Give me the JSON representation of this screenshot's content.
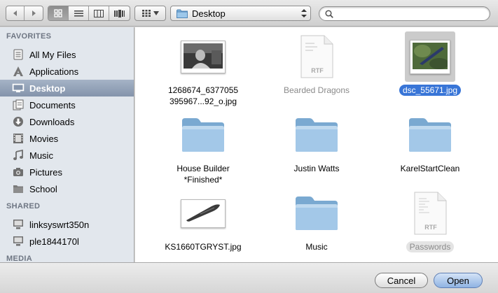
{
  "toolbar": {
    "nav": {
      "back_icon": "chevron-left-icon",
      "forward_icon": "chevron-right-icon"
    },
    "view_modes": [
      "icon-view-icon",
      "list-view-icon",
      "column-view-icon",
      "coverflow-view-icon"
    ],
    "active_view": "icon-view-icon",
    "arrange_icon": "grid-arrange-icon",
    "location": "Desktop",
    "search_value": ""
  },
  "sidebar": {
    "sections": [
      {
        "title": "FAVORITES",
        "items": [
          {
            "label": "All My Files",
            "icon": "all-files-icon"
          },
          {
            "label": "Applications",
            "icon": "applications-icon"
          },
          {
            "label": "Desktop",
            "icon": "desktop-icon",
            "selected": true
          },
          {
            "label": "Documents",
            "icon": "documents-icon"
          },
          {
            "label": "Downloads",
            "icon": "downloads-icon"
          },
          {
            "label": "Movies",
            "icon": "movies-icon"
          },
          {
            "label": "Music",
            "icon": "music-icon"
          },
          {
            "label": "Pictures",
            "icon": "pictures-icon"
          },
          {
            "label": "School",
            "icon": "folder-icon"
          }
        ]
      },
      {
        "title": "SHARED",
        "items": [
          {
            "label": "linksyswrt350n",
            "icon": "network-computer-icon"
          },
          {
            "label": "ple1844170l",
            "icon": "network-computer-icon"
          }
        ]
      },
      {
        "title": "MEDIA",
        "items": []
      }
    ]
  },
  "files": [
    {
      "name_line1": "1268674_6377055",
      "name_line2": "395967...92_o.jpg",
      "kind": "photo-dark"
    },
    {
      "name_line1": "Bearded Dragons",
      "name_line2": "",
      "kind": "rtf",
      "dim": true
    },
    {
      "name_line1": "dsc_55671.jpg",
      "name_line2": "",
      "kind": "photo-green",
      "selected": true
    },
    {
      "name_line1": "House Builder",
      "name_line2": "*Finished*",
      "kind": "folder"
    },
    {
      "name_line1": "Justin Watts",
      "name_line2": "",
      "kind": "folder"
    },
    {
      "name_line1": "KarelStartClean",
      "name_line2": "",
      "kind": "folder"
    },
    {
      "name_line1": "KS1660TGRYST.jpg",
      "name_line2": "",
      "kind": "photo-knife"
    },
    {
      "name_line1": "Music",
      "name_line2": "",
      "kind": "folder"
    },
    {
      "name_line1": "Passwords",
      "name_line2": "",
      "kind": "rtf",
      "dim": true,
      "pill": true
    }
  ],
  "rtf_badge": "RTF",
  "buttons": {
    "cancel": "Cancel",
    "open": "Open"
  }
}
